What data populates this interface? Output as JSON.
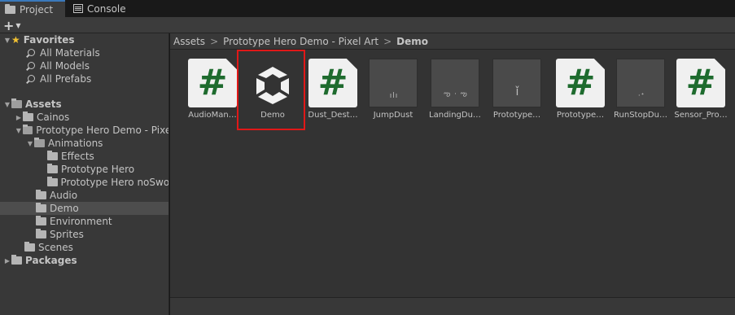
{
  "tabs": [
    {
      "label": "Project",
      "icon": "folder-icon",
      "active": true
    },
    {
      "label": "Console",
      "icon": "console-icon",
      "active": false
    }
  ],
  "toolbar": {
    "add_label": "+",
    "add_menu_icon": "chevron-down-icon"
  },
  "favorites": {
    "label": "Favorites",
    "items": [
      "All Materials",
      "All Models",
      "All Prefabs"
    ]
  },
  "tree": {
    "assets_label": "Assets",
    "cainos": "Cainos",
    "prototype_hero_demo": "Prototype Hero Demo - Pixel",
    "animations": "Animations",
    "effects": "Effects",
    "prototype_hero": "Prototype Hero",
    "prototype_hero_nosword": "Prototype Hero noSwor",
    "audio": "Audio",
    "demo": "Demo",
    "environment": "Environment",
    "sprites": "Sprites",
    "scenes": "Scenes",
    "packages_label": "Packages"
  },
  "breadcrumb": {
    "root": "Assets",
    "middle": "Prototype Hero Demo - Pixel Art",
    "current": "Demo",
    "separator": ">"
  },
  "assets": [
    {
      "name": "AudioMan…",
      "type": "script"
    },
    {
      "name": "Demo",
      "type": "scene",
      "highlighted": true
    },
    {
      "name": "Dust_Dest…",
      "type": "script"
    },
    {
      "name": "JumpDust",
      "type": "sprite"
    },
    {
      "name": "LandingDu…",
      "type": "sprite"
    },
    {
      "name": "Prototype…",
      "type": "sprite"
    },
    {
      "name": "Prototype…",
      "type": "script"
    },
    {
      "name": "RunStopDu…",
      "type": "sprite"
    },
    {
      "name": "Sensor_Pro…",
      "type": "script"
    }
  ],
  "colors": {
    "script_hash": "#1e6b2e",
    "highlight": "#e01818",
    "star": "#f2c232"
  }
}
